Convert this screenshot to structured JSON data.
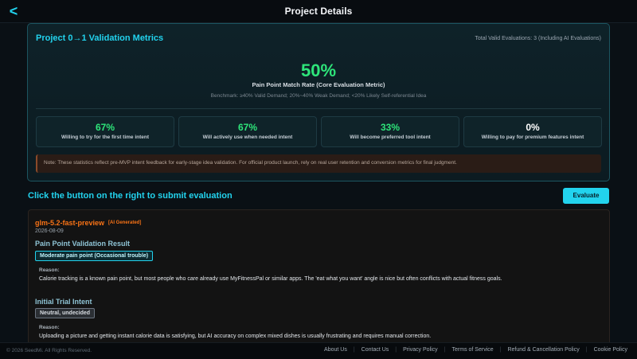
{
  "header": {
    "back_label": "<",
    "title": "Project Details"
  },
  "metrics": {
    "title": "Project 0→1 Validation Metrics",
    "total": "Total Valid Evaluations: 3 (Including AI Evaluations)",
    "hero_value": "50%",
    "hero_label": "Pain Point Match Rate (Core Evaluation Metric)",
    "benchmark": "Benchmark: ≥40% Valid Demand; 20%~40% Weak Demand; <20% Likely Self-referential Idea",
    "stats": [
      {
        "value": "67%",
        "label": "Willing to try for the first time intent"
      },
      {
        "value": "67%",
        "label": "Will actively use when needed intent"
      },
      {
        "value": "33%",
        "label": "Will become preferred tool intent"
      },
      {
        "value": "0%",
        "label": "Willing to pay for premium features intent"
      }
    ],
    "note": "Note: These statistics reflect pre-MVP intent feedback for early-stage idea validation. For official product launch, rely on real user retention and conversion metrics for final judgment."
  },
  "submit": {
    "heading": "Click the button on the right to submit evaluation",
    "button_label": "Evaluate"
  },
  "evaluation": {
    "model": "glm-5.2-fast-preview",
    "tag": "[AI Generated]",
    "date": "2026-08-09",
    "sections": [
      {
        "title": "Pain Point Validation Result",
        "badge": "Moderate pain point (Occasional trouble)",
        "reason_label": "Reason:",
        "reason": "Calorie tracking is a known pain point, but most people who care already use MyFitnessPal or similar apps. The 'eat what you want' angle is nice but often conflicts with actual fitness goals."
      },
      {
        "title": "Initial Trial Intent",
        "badge": "Neutral, undecided",
        "reason_label": "Reason:",
        "reason": "Uploading a picture and getting instant calorie data is satisfying, but AI accuracy on complex mixed dishes is usually frustrating and requires manual correction."
      }
    ]
  },
  "footer": {
    "copyright": "© 2026 SeedMi. All Rights Reserved.",
    "links": [
      "About Us",
      "Contact Us",
      "Privacy Policy",
      "Terms of Service",
      "Refund & Cancellation Policy",
      "Cookie Policy"
    ]
  },
  "colors": {
    "accent": "#22d3ee",
    "success": "#2ee57a",
    "warning": "#f97316"
  }
}
